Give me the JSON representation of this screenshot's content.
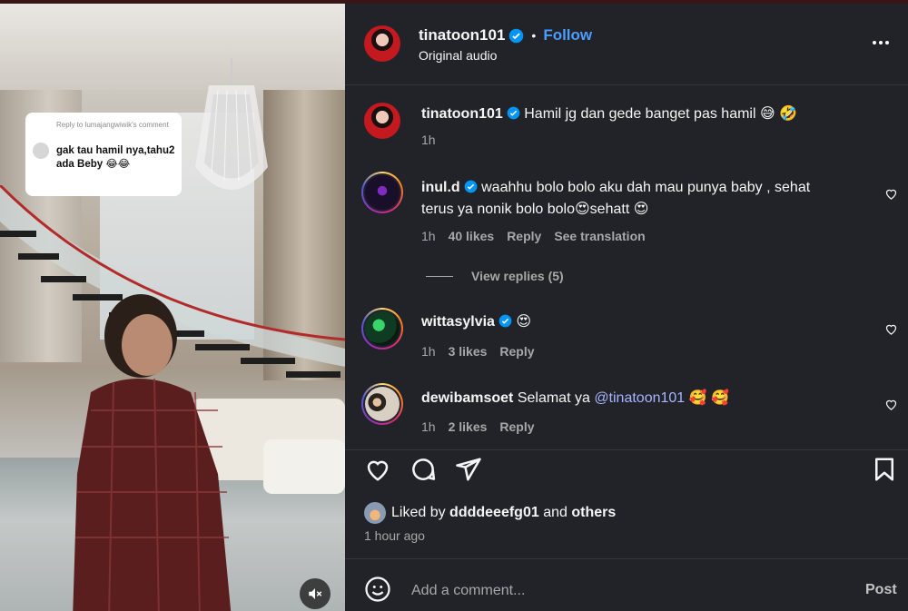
{
  "post": {
    "username": "tinatoon101",
    "follow_label": "Follow",
    "audio_label": "Original audio",
    "separator": "•"
  },
  "video": {
    "reply_header": "Reply to lumajangwiwik's comment",
    "reply_text": "gak tau hamil nya,tahu2 ada Beby 😂😂",
    "mute_icon": "muted-speaker-icon"
  },
  "comments": [
    {
      "username": "tinatoon101",
      "verified": true,
      "text": "Hamil jg dan gede banget pas hamil",
      "emojis": [
        "😅",
        "🤣"
      ],
      "time": "1h"
    },
    {
      "username": "inul.d",
      "verified": true,
      "text_line1": "waahhu bolo bolo aku dah mau punya baby , sehat",
      "text_line2": "terus ya nonik bolo bolo😍sehatt 😍",
      "time": "1h",
      "likes": "40 likes",
      "reply_label": "Reply",
      "translate_label": "See translation",
      "view_replies": "View replies (5)"
    },
    {
      "username": "wittasylvia",
      "verified": true,
      "text": "😍",
      "time": "1h",
      "likes": "3 likes",
      "reply_label": "Reply"
    },
    {
      "username": "dewibamsoet",
      "verified": false,
      "text": "Selamat ya",
      "mention": "@tinatoon101",
      "emojis": [
        "🥰",
        "🥰"
      ],
      "time": "1h",
      "likes": "2 likes",
      "reply_label": "Reply"
    }
  ],
  "actions": {
    "like_icon": "heart-icon",
    "comment_icon": "comment-icon",
    "share_icon": "share-icon",
    "save_icon": "bookmark-icon"
  },
  "likes_summary": {
    "prefix": "Liked by",
    "user": "ddddeeefg01",
    "and": "and",
    "others": "others",
    "time_ago": "1 hour ago"
  },
  "composer": {
    "placeholder": "Add a comment...",
    "post_label": "Post"
  },
  "colors": {
    "panel_bg": "#212328",
    "accent": "#0095f6",
    "link": "#a8b4ff",
    "muted_text": "#a8a8a8"
  }
}
